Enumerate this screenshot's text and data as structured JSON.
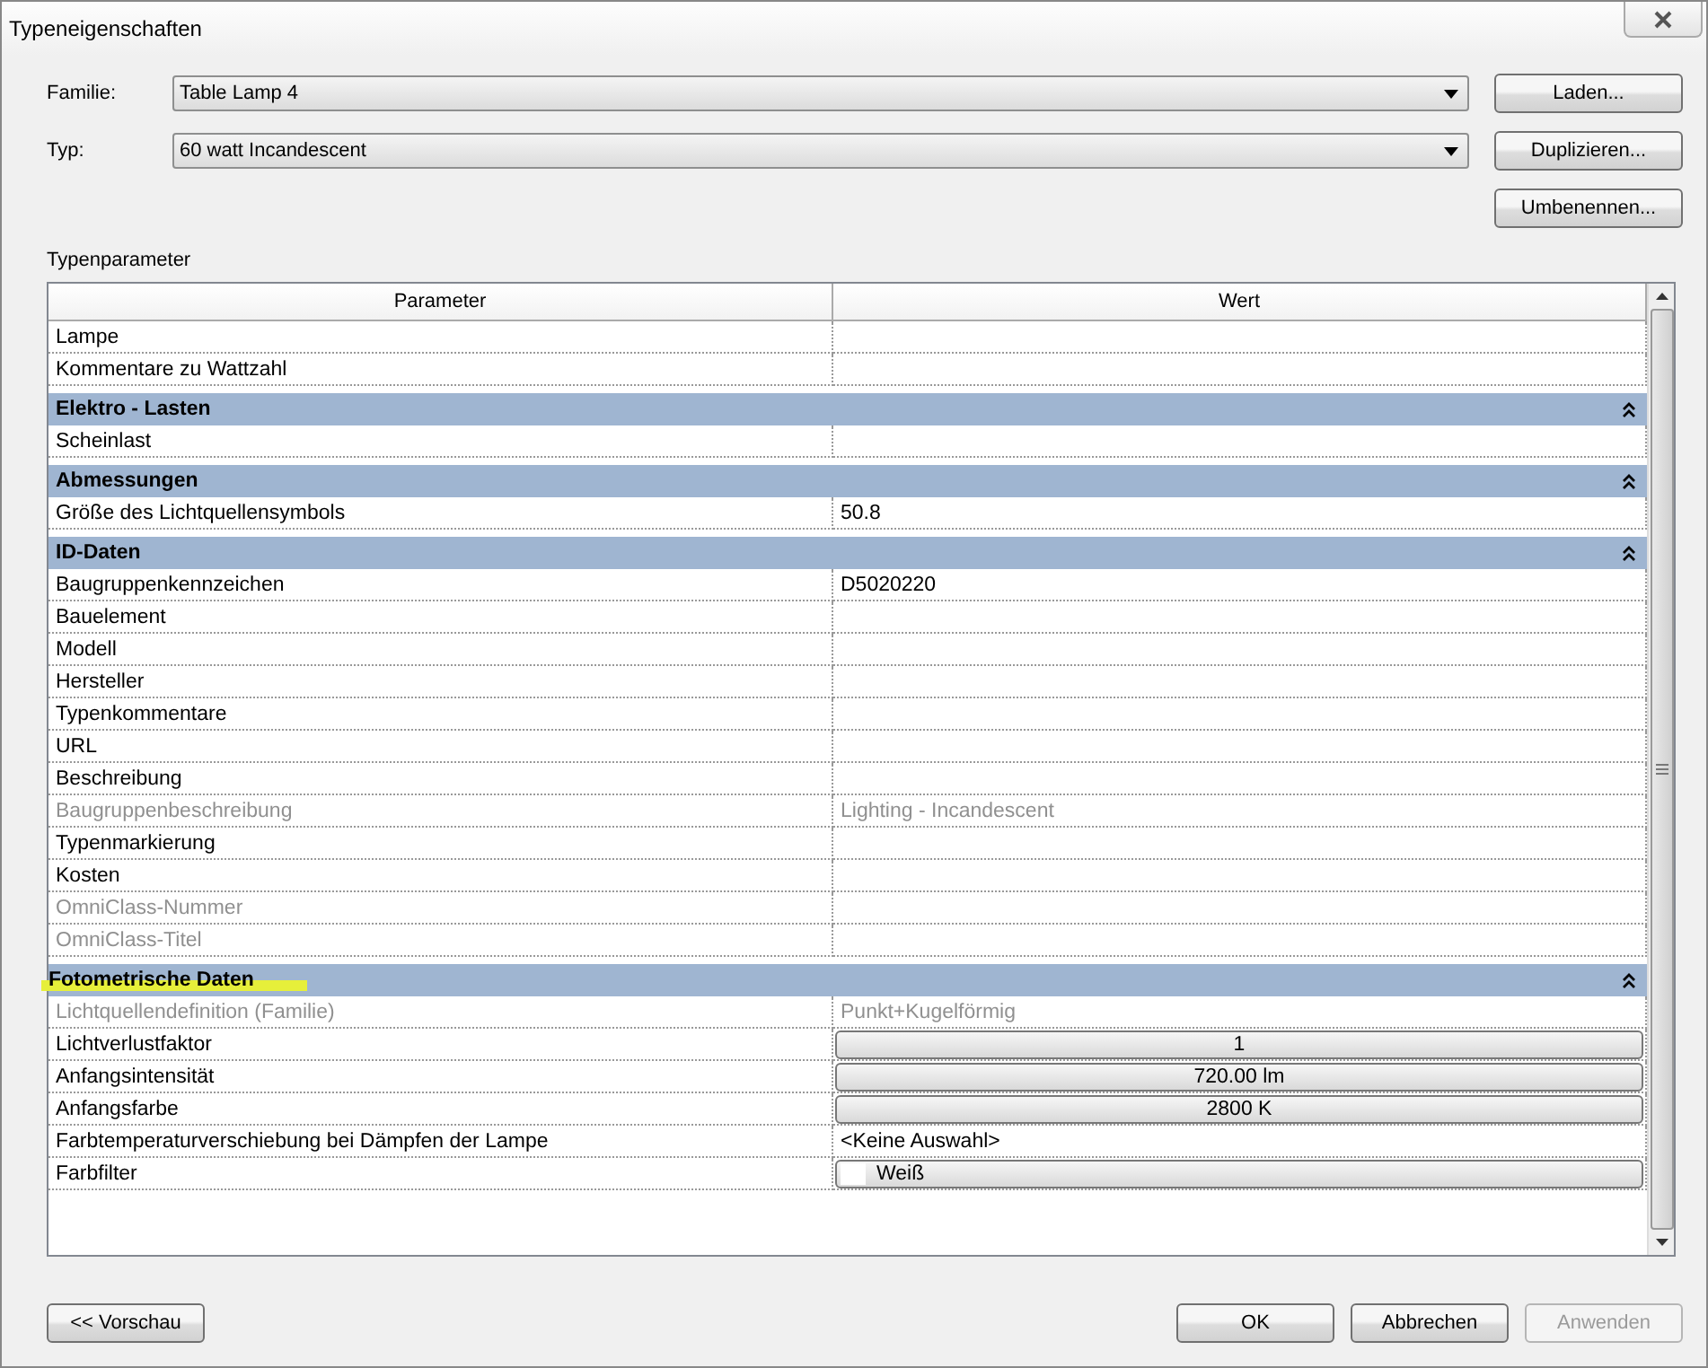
{
  "window": {
    "title": "Typeneigenschaften"
  },
  "fields": [
    {
      "label": "Familie:",
      "value": "Table Lamp 4"
    },
    {
      "label": "Typ:",
      "value": "60 watt Incandescent"
    }
  ],
  "side_buttons": [
    "Laden...",
    "Duplizieren...",
    "Umbenennen..."
  ],
  "section_label": "Typenparameter",
  "table": {
    "columns": [
      "Parameter",
      "Wert"
    ],
    "rows": [
      {
        "kind": "text",
        "name": "Lampe",
        "disabled": false
      },
      {
        "kind": "text",
        "name": "Kommentare zu Wattzahl",
        "disabled": false
      },
      {
        "kind": "group",
        "name": "Elektro - Lasten",
        "expanded": true,
        "highlighted": false
      },
      {
        "kind": "text",
        "name": "Scheinlast",
        "disabled": false
      },
      {
        "kind": "group",
        "name": "Abmessungen",
        "expanded": true,
        "highlighted": false
      },
      {
        "kind": "text",
        "name": "Größe des Lichtquellensymbols",
        "value": "50.8",
        "disabled": false
      },
      {
        "kind": "group",
        "name": "ID-Daten",
        "expanded": true,
        "highlighted": false
      },
      {
        "kind": "text",
        "name": "Baugruppenkennzeichen",
        "value": "D5020220",
        "disabled": false
      },
      {
        "kind": "text",
        "name": "Bauelement",
        "disabled": false
      },
      {
        "kind": "text",
        "name": "Modell",
        "disabled": false
      },
      {
        "kind": "text",
        "name": "Hersteller",
        "disabled": false
      },
      {
        "kind": "text",
        "name": "Typenkommentare",
        "disabled": false
      },
      {
        "kind": "text",
        "name": "URL",
        "disabled": false
      },
      {
        "kind": "text",
        "name": "Beschreibung",
        "disabled": false
      },
      {
        "kind": "text",
        "name": "Baugruppenbeschreibung",
        "value": "Lighting - Incandescent",
        "disabled": true
      },
      {
        "kind": "text",
        "name": "Typenmarkierung",
        "disabled": false
      },
      {
        "kind": "text",
        "name": "Kosten",
        "disabled": false
      },
      {
        "kind": "text",
        "name": "OmniClass-Nummer",
        "disabled": true
      },
      {
        "kind": "text",
        "name": "OmniClass-Titel",
        "disabled": true
      },
      {
        "kind": "group",
        "name": "Fotometrische Daten",
        "expanded": true,
        "highlighted": true
      },
      {
        "kind": "text",
        "name": "Lichtquellendefinition (Familie)",
        "value": "Punkt+Kugelförmig",
        "disabled": true
      },
      {
        "kind": "button",
        "name": "Lichtverlustfaktor",
        "value": "1",
        "disabled": false
      },
      {
        "kind": "button",
        "name": "Anfangsintensität",
        "value": "720.00 lm",
        "disabled": false
      },
      {
        "kind": "button",
        "name": "Anfangsfarbe",
        "value": "2800 K",
        "disabled": false
      },
      {
        "kind": "text",
        "name": "Farbtemperaturverschiebung bei Dämpfen der Lampe",
        "value": "<Keine Auswahl>",
        "disabled": false
      },
      {
        "kind": "swatch",
        "name": "Farbfilter",
        "value": "Weiß",
        "color": "#ffffff",
        "disabled": false
      }
    ]
  },
  "preview_button": "<< Vorschau",
  "buttons": [
    {
      "label": "OK",
      "disabled": false
    },
    {
      "label": "Abbrechen",
      "disabled": false
    },
    {
      "label": "Anwenden",
      "disabled": true
    }
  ]
}
